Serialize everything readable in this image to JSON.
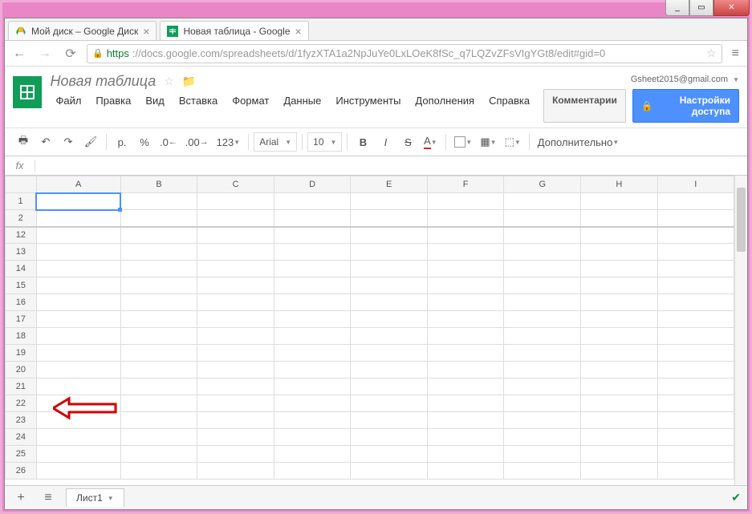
{
  "window": {
    "min": "_",
    "max": "▭",
    "close": "✕"
  },
  "tabs": [
    {
      "title": "Мой диск – Google Диск",
      "icon": "drive"
    },
    {
      "title": "Новая таблица - Google",
      "icon": "sheets"
    }
  ],
  "addr": {
    "https": "https",
    "rest": "://docs.google.com/spreadsheets/d/1fyzXTA1a2NpJuYe0LxLOeK8fSc_q7LQZvZFsVIgYGt8/edit#gid=0"
  },
  "account": {
    "email": "Gsheet2015@gmail.com"
  },
  "doc_title": "Новая таблица",
  "menus": [
    "Файл",
    "Правка",
    "Вид",
    "Вставка",
    "Формат",
    "Данные",
    "Инструменты",
    "Дополнения",
    "Справка"
  ],
  "buttons": {
    "comments": "Комментарии",
    "share": "Настройки доступа"
  },
  "toolbar": {
    "currency": "р.",
    "percent": "%",
    "dec_dec": ".0",
    "dec_inc": ".00",
    "fmt": "123",
    "font": "Arial",
    "size": "10",
    "more": "Дополнительно"
  },
  "fx": "fx",
  "cols": [
    "A",
    "B",
    "C",
    "D",
    "E",
    "F",
    "G",
    "H",
    "I"
  ],
  "rows": [
    "1",
    "2",
    "12",
    "13",
    "14",
    "15",
    "16",
    "17",
    "18",
    "19",
    "20",
    "21",
    "22",
    "23",
    "24",
    "25",
    "26"
  ],
  "sheet": {
    "name": "Лист1"
  }
}
